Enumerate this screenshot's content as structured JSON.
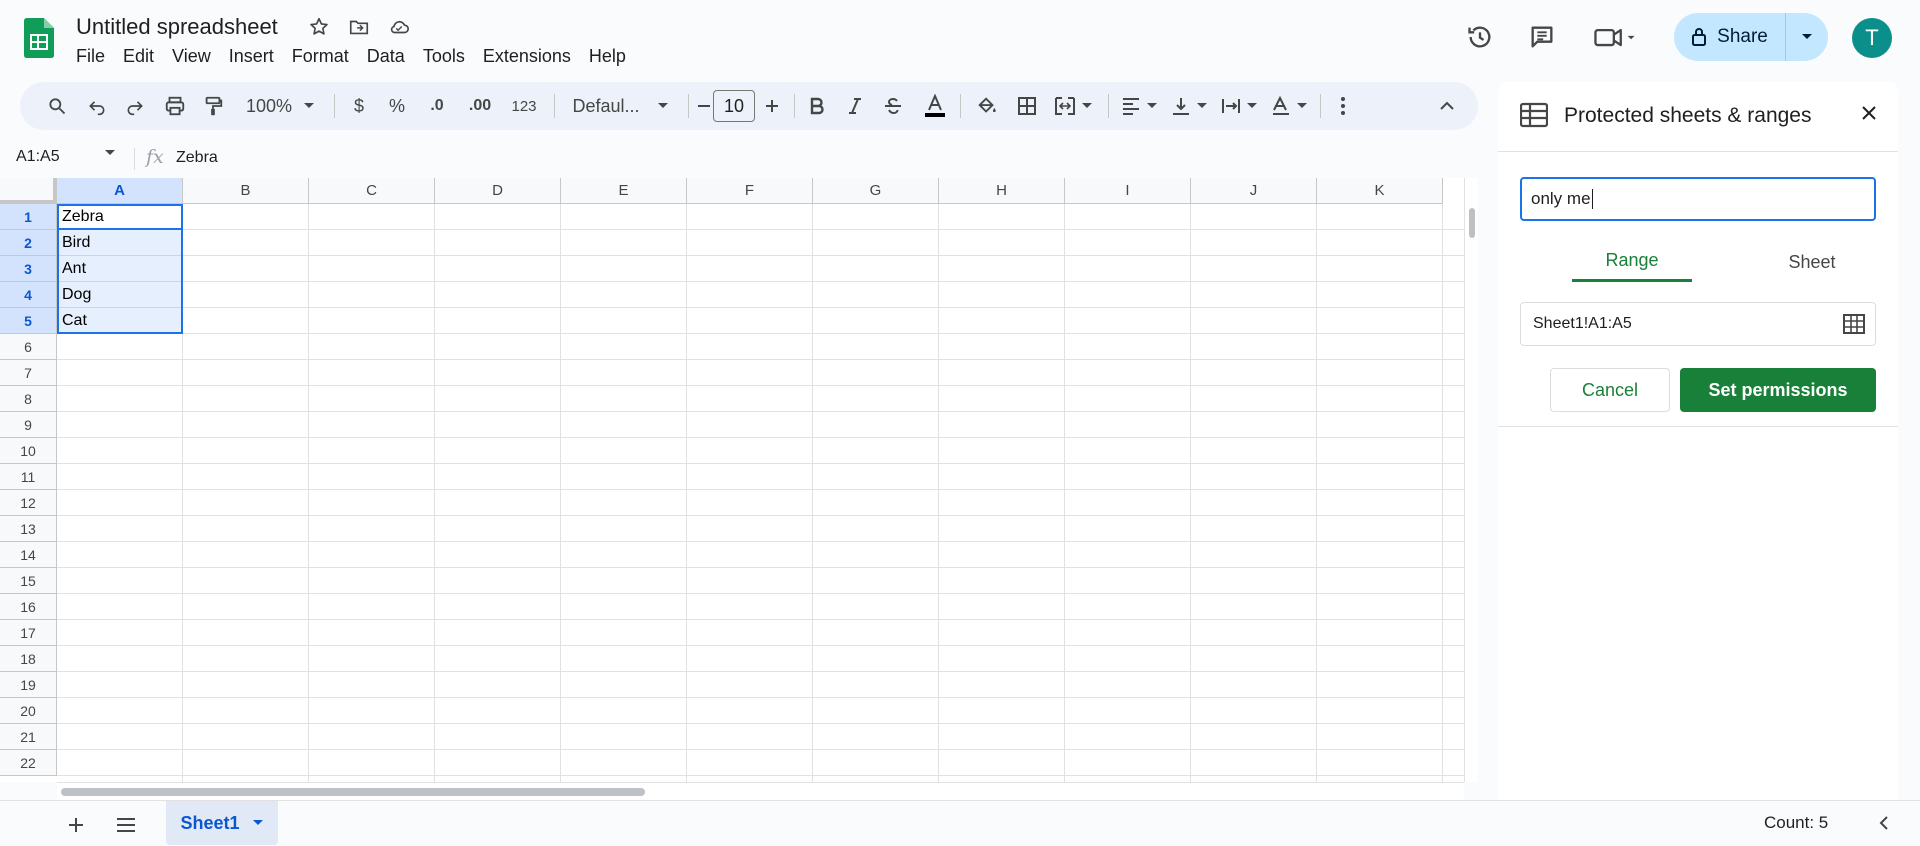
{
  "app": {
    "doc_title": "Untitled spreadsheet",
    "menu": [
      "File",
      "Edit",
      "View",
      "Insert",
      "Format",
      "Data",
      "Tools",
      "Extensions",
      "Help"
    ],
    "share_label": "Share",
    "avatar_initial": "T"
  },
  "toolbar": {
    "zoom": "100%",
    "currency": "$",
    "percent": "%",
    "decrease_decimal": ".0",
    "increase_decimal": ".00",
    "number_format": "123",
    "font": "Defaul...",
    "font_size": "10"
  },
  "formula_bar": {
    "name_box": "A1:A5",
    "fx": "fx",
    "value": "Zebra"
  },
  "grid": {
    "columns": [
      "A",
      "B",
      "C",
      "D",
      "E",
      "F",
      "G",
      "H",
      "I",
      "J",
      "K"
    ],
    "rows": [
      "1",
      "2",
      "3",
      "4",
      "5",
      "6",
      "7",
      "8",
      "9",
      "10",
      "11",
      "12",
      "13",
      "14",
      "15",
      "16",
      "17",
      "18",
      "19",
      "20",
      "21",
      "22"
    ],
    "cells_A": [
      "Zebra",
      "Bird",
      "Ant",
      "Dog",
      "Cat"
    ]
  },
  "bottom": {
    "sheet_tab": "Sheet1",
    "count": "Count: 5"
  },
  "panel": {
    "title": "Protected sheets & ranges",
    "description_value": "only me",
    "tab_range": "Range",
    "tab_sheet": "Sheet",
    "range_value": "Sheet1!A1:A5",
    "cancel_label": "Cancel",
    "set_permissions_label": "Set permissions"
  },
  "colors": {
    "accent_green": "#188038",
    "selection_blue": "#1a73e8",
    "share_bg": "#c2e7ff"
  }
}
